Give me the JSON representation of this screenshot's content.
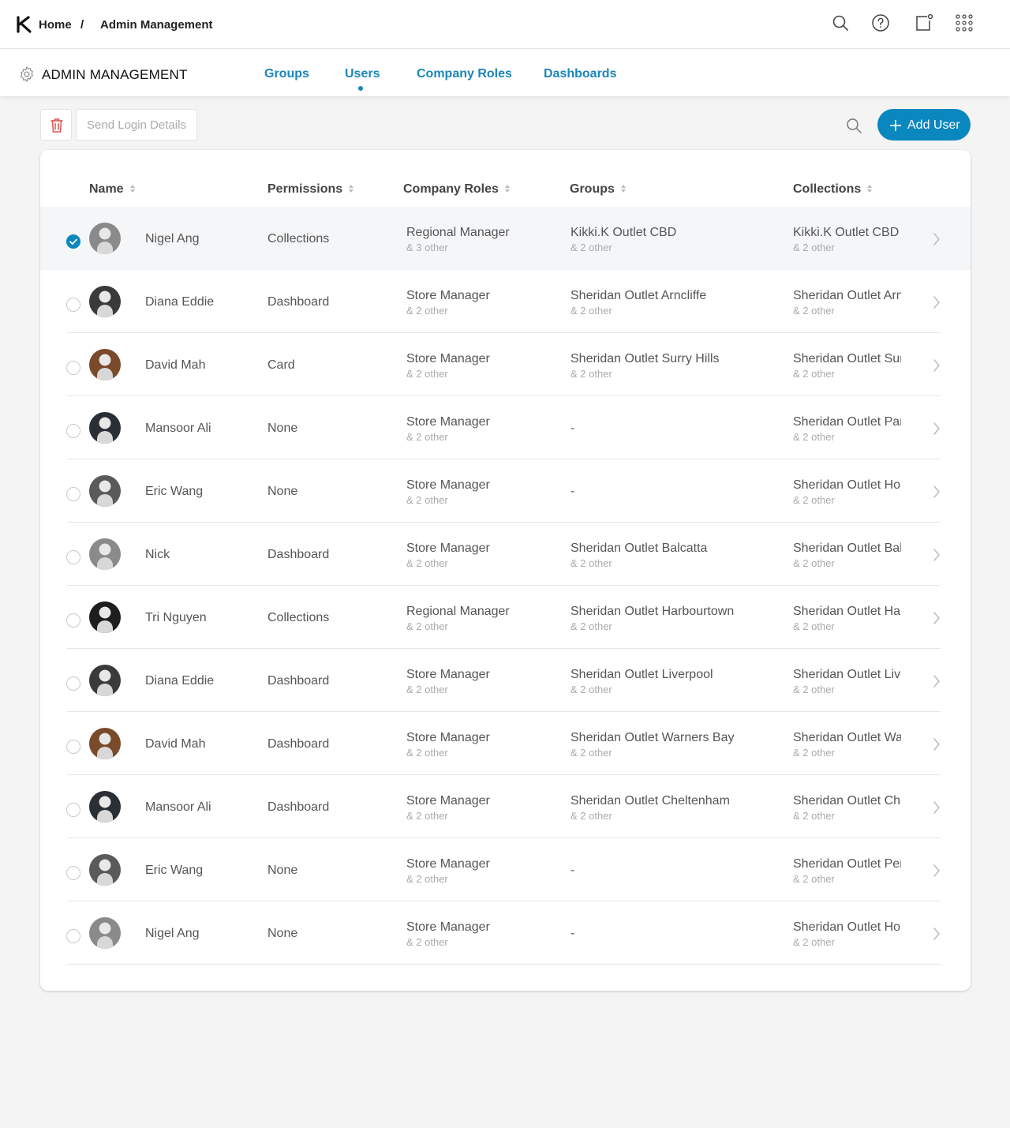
{
  "breadcrumb": {
    "home": "Home",
    "separator": "/",
    "current": "Admin Management"
  },
  "header": {
    "title": "ADMIN MANAGEMENT"
  },
  "tabs": [
    {
      "label": "Groups",
      "active": false
    },
    {
      "label": "Users",
      "active": true
    },
    {
      "label": "Company Roles",
      "active": false
    },
    {
      "label": "Dashboards",
      "active": false
    }
  ],
  "toolbar": {
    "send_login_label": "Send Login Details",
    "add_user_label": "Add User"
  },
  "table": {
    "columns": [
      "Name",
      "Permissions",
      "Company Roles",
      "Groups",
      "Collections"
    ],
    "rows": [
      {
        "selected": true,
        "avatar_tone": "#8a8a8a",
        "name": "Nigel Ang",
        "permission": "Collections",
        "role": "Regional Manager",
        "role_sub": "& 3 other",
        "group": "Kikki.K Outlet CBD",
        "group_sub": "& 2 other",
        "collection": "Kikki.K Outlet CBD",
        "collection_sub": "& 2 other"
      },
      {
        "selected": false,
        "avatar_tone": "#3a3a3a",
        "name": "Diana Eddie",
        "permission": "Dashboard",
        "role": "Store Manager",
        "role_sub": "& 2 other",
        "group": "Sheridan Outlet Arncliffe",
        "group_sub": "& 2 other",
        "collection": "Sheridan Outlet Arncliffe",
        "collection_sub": "& 2 other"
      },
      {
        "selected": false,
        "avatar_tone": "#7a4a2a",
        "name": "David Mah",
        "permission": "Card",
        "role": "Store Manager",
        "role_sub": "& 2 other",
        "group": "Sheridan Outlet Surry Hills",
        "group_sub": "& 2 other",
        "collection": "Sheridan Outlet Surry Hills",
        "collection_sub": "& 2 other"
      },
      {
        "selected": false,
        "avatar_tone": "#2a2f35",
        "name": "Mansoor Ali",
        "permission": "None",
        "role": "Store Manager",
        "role_sub": "& 2 other",
        "group": "-",
        "group_sub": "",
        "collection": "Sheridan Outlet Parramatta",
        "collection_sub": "& 2 other"
      },
      {
        "selected": false,
        "avatar_tone": "#5a5a5a",
        "name": "Eric Wang",
        "permission": "None",
        "role": "Store Manager",
        "role_sub": "& 2 other",
        "group": "-",
        "group_sub": "",
        "collection": "Sheridan Outlet Homebush",
        "collection_sub": "& 2 other"
      },
      {
        "selected": false,
        "avatar_tone": "#8a8a8a",
        "name": "Nick",
        "permission": "Dashboard",
        "role": "Store Manager",
        "role_sub": "& 2 other",
        "group": "Sheridan Outlet Balcatta",
        "group_sub": "& 2 other",
        "collection": "Sheridan Outlet Balcatta",
        "collection_sub": "& 2 other"
      },
      {
        "selected": false,
        "avatar_tone": "#1e1e1e",
        "name": "Tri Nguyen",
        "permission": "Collections",
        "role": "Regional Manager",
        "role_sub": "& 2 other",
        "group": "Sheridan Outlet Harbourtown",
        "group_sub": "& 2 other",
        "collection": "Sheridan Outlet Harbourtown",
        "collection_sub": "& 2 other"
      },
      {
        "selected": false,
        "avatar_tone": "#3a3a3a",
        "name": "Diana Eddie",
        "permission": "Dashboard",
        "role": "Store Manager",
        "role_sub": "& 2 other",
        "group": "Sheridan Outlet Liverpool",
        "group_sub": "& 2 other",
        "collection": "Sheridan Outlet Liverpool",
        "collection_sub": "& 2 other"
      },
      {
        "selected": false,
        "avatar_tone": "#7a4a2a",
        "name": "David Mah",
        "permission": "Dashboard",
        "role": "Store Manager",
        "role_sub": "& 2 other",
        "group": "Sheridan Outlet Warners Bay",
        "group_sub": "& 2 other",
        "collection": "Sheridan Outlet Warners Bay",
        "collection_sub": "& 2 other"
      },
      {
        "selected": false,
        "avatar_tone": "#2a2f35",
        "name": "Mansoor Ali",
        "permission": "Dashboard",
        "role": "Store Manager",
        "role_sub": "& 2 other",
        "group": "Sheridan Outlet Cheltenham",
        "group_sub": "& 2 other",
        "collection": "Sheridan Outlet Cheltenham",
        "collection_sub": "& 2 other"
      },
      {
        "selected": false,
        "avatar_tone": "#5a5a5a",
        "name": "Eric Wang",
        "permission": "None",
        "role": "Store Manager",
        "role_sub": "& 2 other",
        "group": "-",
        "group_sub": "",
        "collection": "Sheridan Outlet Penrith",
        "collection_sub": "& 2 other"
      },
      {
        "selected": false,
        "avatar_tone": "#8a8a8a",
        "name": "Nigel Ang",
        "permission": "None",
        "role": "Store Manager",
        "role_sub": "& 2 other",
        "group": "-",
        "group_sub": "",
        "collection": "Sheridan Outlet Hornsby",
        "collection_sub": "& 2 other"
      }
    ]
  },
  "colors": {
    "accent": "#0b87bf",
    "tab_text": "#1a86b8",
    "delete_icon": "#d9534f"
  },
  "icons": [
    "app-logo-icon",
    "search-icon",
    "help-icon",
    "notifications-icon",
    "apps-grid-icon",
    "gear-icon",
    "trash-icon",
    "plus-icon",
    "sort-icon",
    "chevron-right-icon",
    "check-icon"
  ]
}
